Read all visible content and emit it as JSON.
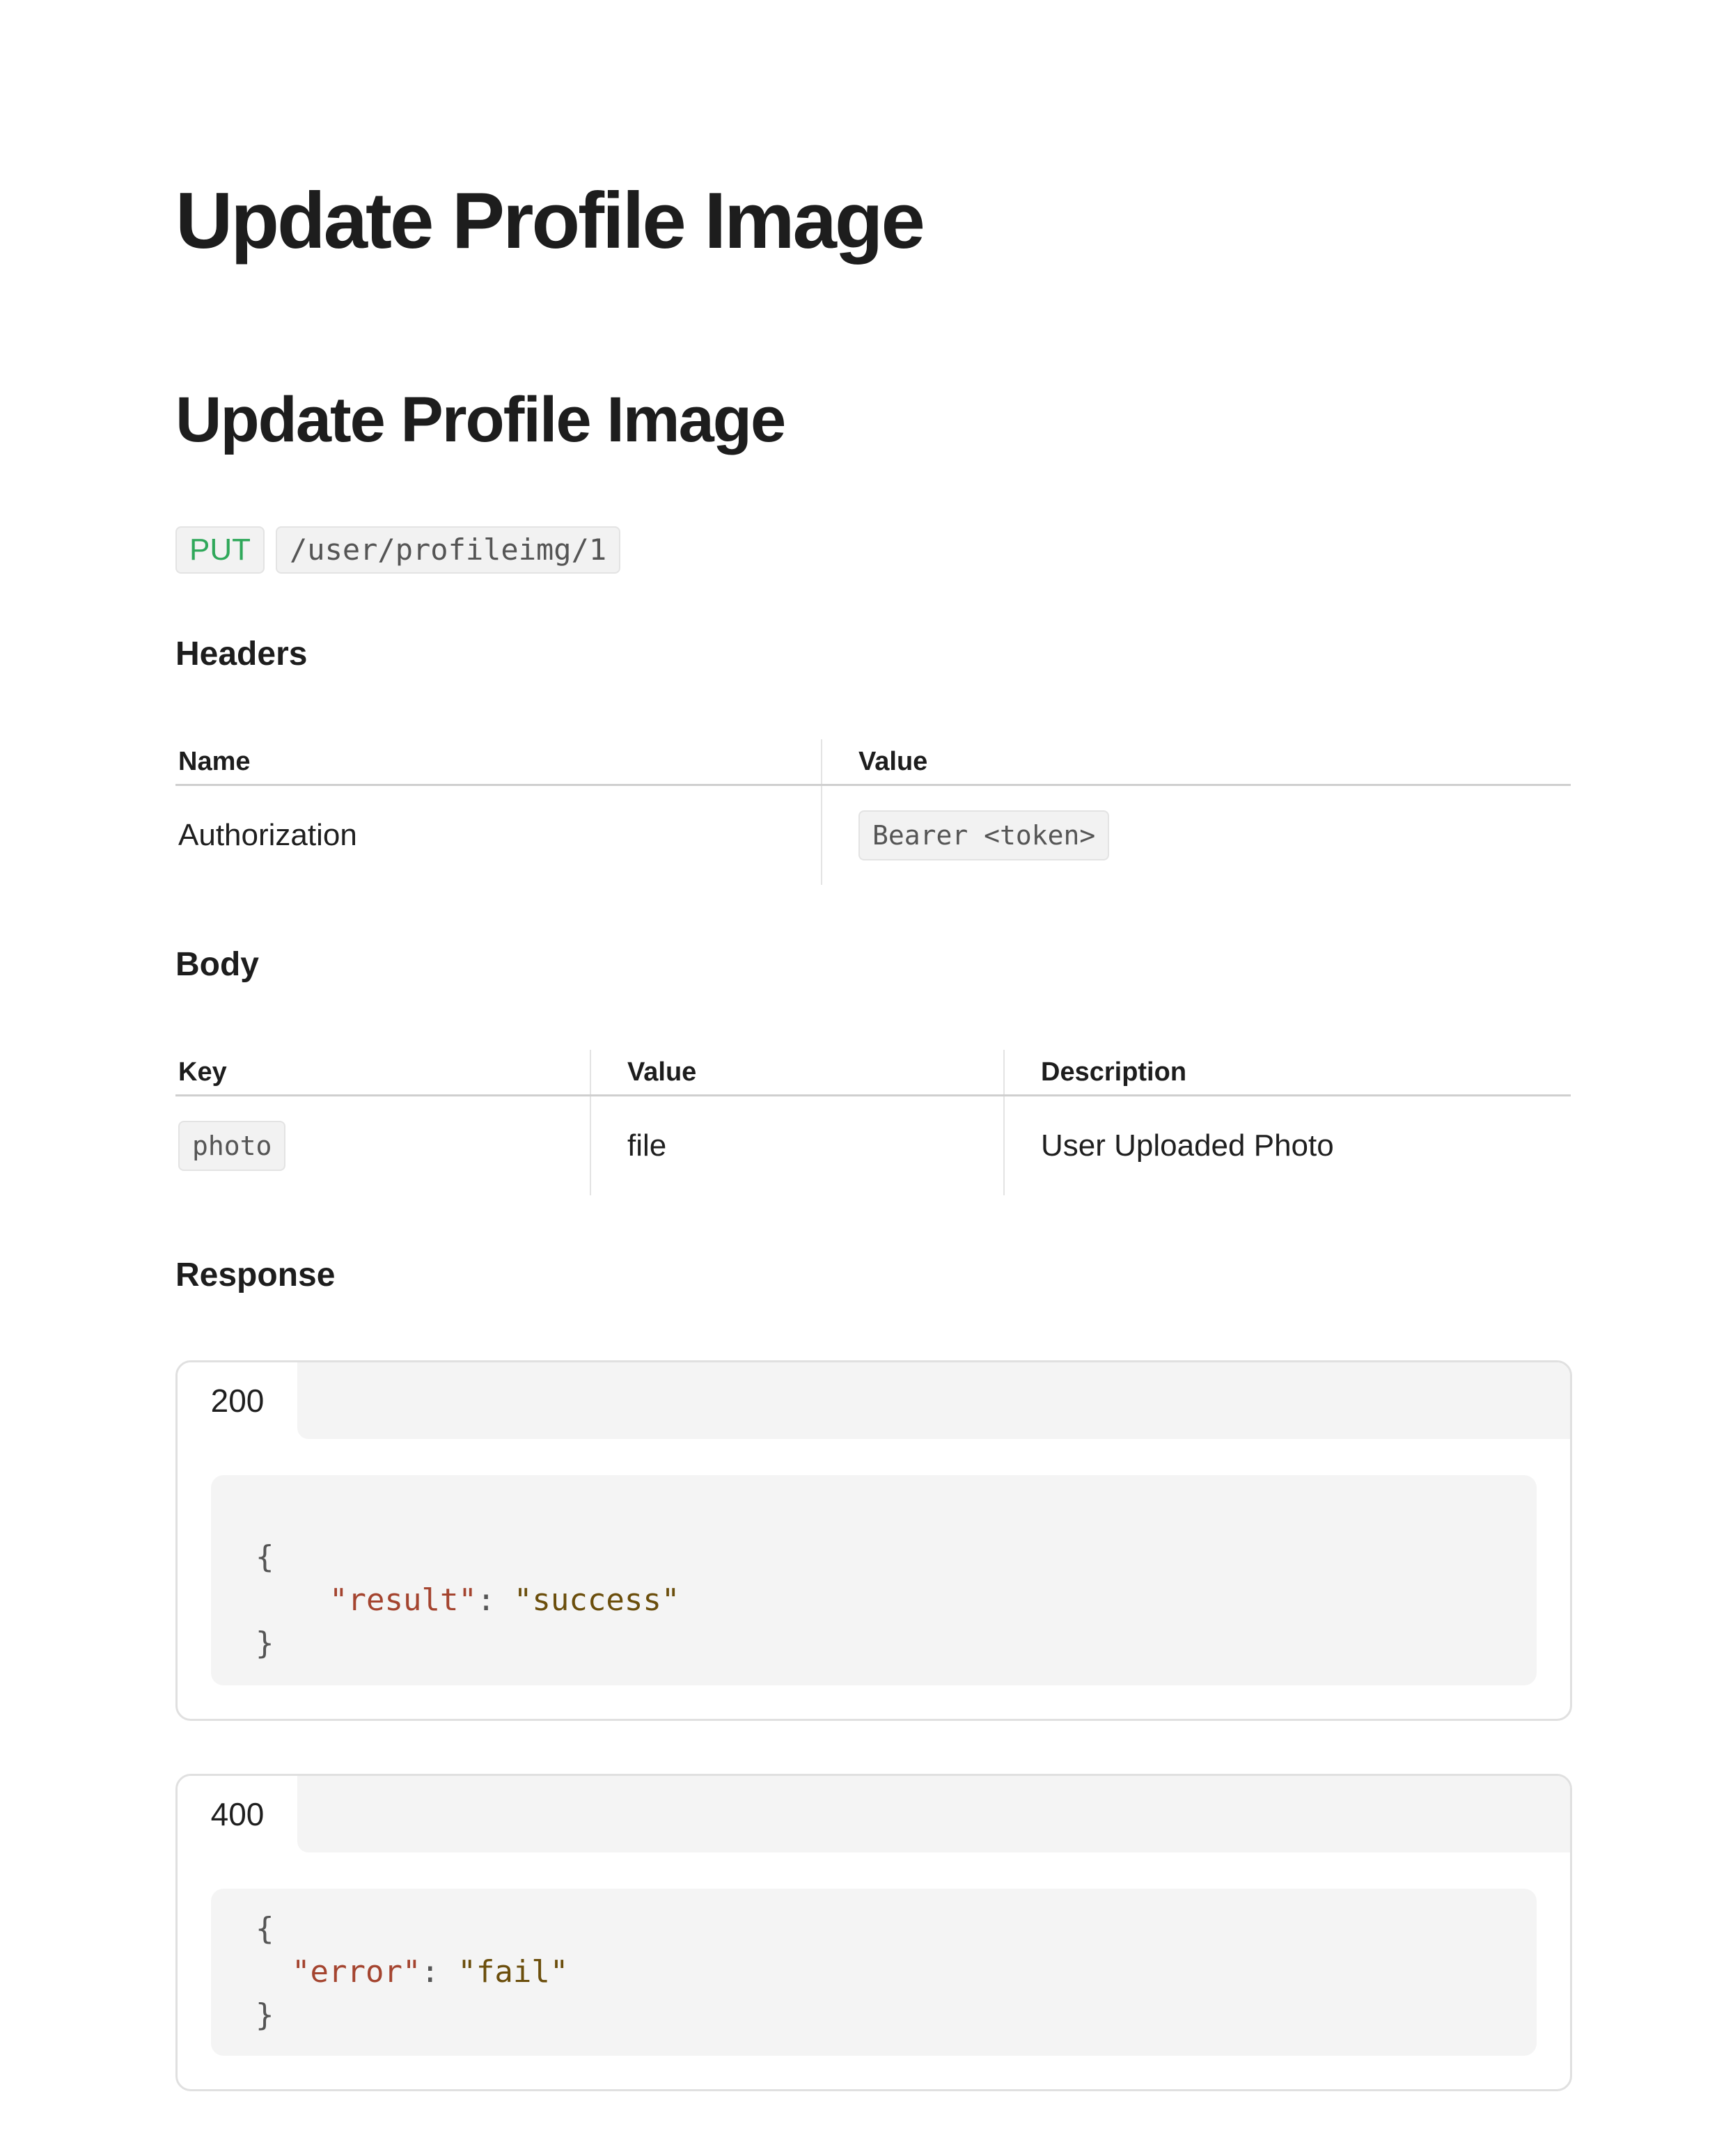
{
  "page": {
    "title": "Update Profile Image",
    "section_title": "Update Profile Image"
  },
  "endpoint": {
    "method": "PUT",
    "path": "/user/profileimg/1"
  },
  "headers": {
    "heading": "Headers",
    "columns": [
      "Name",
      "Value"
    ],
    "rows": [
      {
        "name": "Authorization",
        "value": "Bearer <token>"
      }
    ]
  },
  "body": {
    "heading": "Body",
    "columns": [
      "Key",
      "Value",
      "Description"
    ],
    "rows": [
      {
        "key": "photo",
        "value": "file",
        "description": "User Uploaded Photo"
      }
    ]
  },
  "response": {
    "heading": "Response",
    "cards": [
      {
        "status": "200",
        "open_brace": "{",
        "key": "\"result\"",
        "colon": ": ",
        "value": "\"success\"",
        "close_brace": "}"
      },
      {
        "status": "400",
        "open_brace": "{",
        "key": "\"error\"",
        "colon": ": ",
        "value": "\"fail\"",
        "close_brace": "}"
      }
    ]
  },
  "colors": {
    "method_put": "#2fa85a",
    "json_key": "#a4442f",
    "json_string": "#6b4e0c",
    "code_background": "#f4f4f4",
    "border": "#e0e0e0"
  }
}
